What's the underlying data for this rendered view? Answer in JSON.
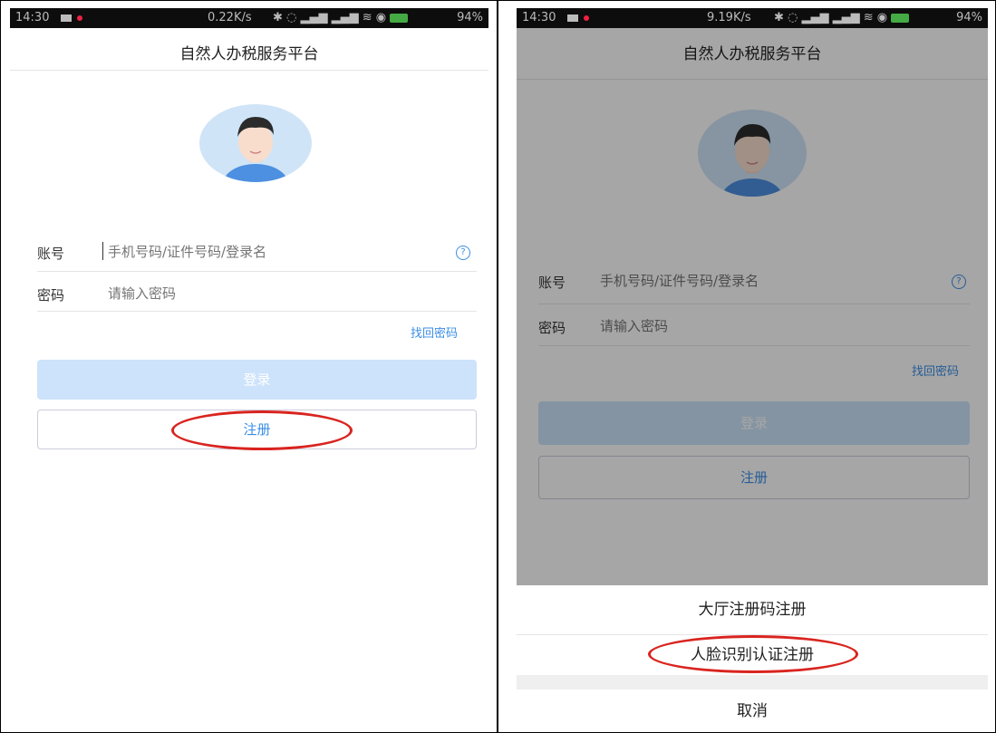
{
  "status_bar_left": {
    "time": "14:30",
    "net_speed": "0.22K/s",
    "battery": "94%"
  },
  "status_bar_right": {
    "time": "14:30",
    "net_speed": "9.19K/s",
    "battery": "94%"
  },
  "app": {
    "title": "自然人办税服务平台"
  },
  "login": {
    "account_label": "账号",
    "account_placeholder": "手机号码/证件号码/登录名",
    "password_label": "密码",
    "password_placeholder": "请输入密码",
    "help_symbol": "?",
    "forgot_password": "找回密码",
    "login_button": "登录",
    "register_button": "注册"
  },
  "register_sheet": {
    "option_hall_code": "大厅注册码注册",
    "option_face": "人脸识别认证注册",
    "cancel": "取消"
  },
  "colors": {
    "accent": "#3a8ee6",
    "highlight_oval": "#d9241f",
    "login_disabled": "#cde3fb"
  },
  "icons": [
    "avatar-icon",
    "help-circle-icon",
    "wifi-icon",
    "battery-icon"
  ]
}
